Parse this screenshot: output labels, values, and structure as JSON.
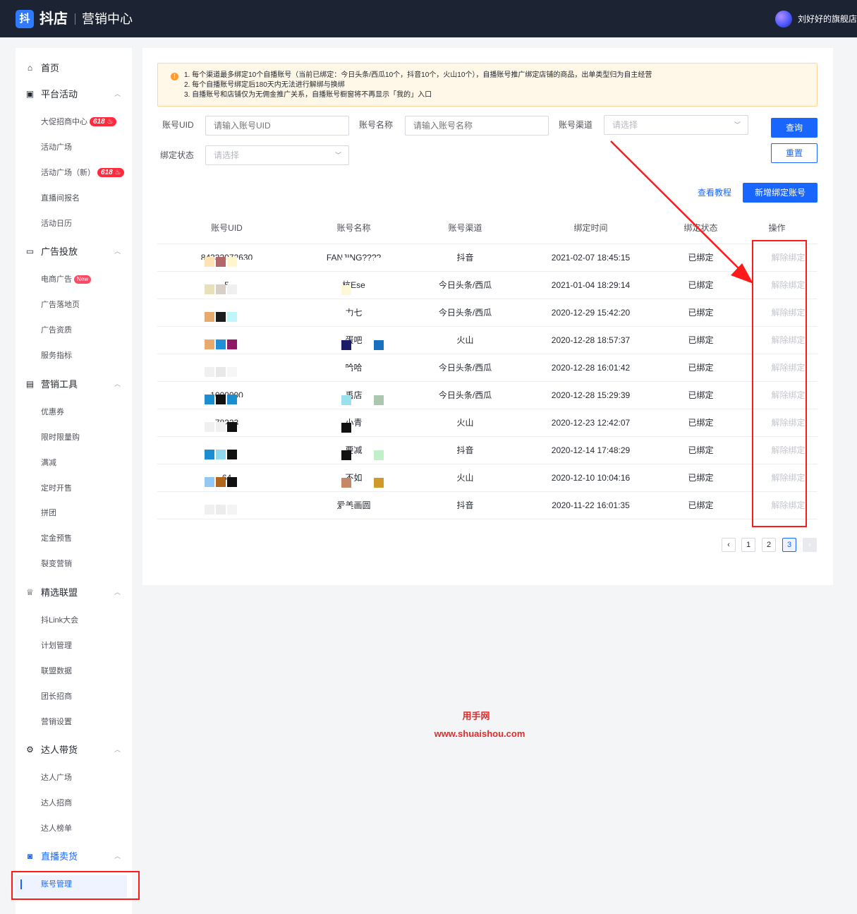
{
  "topbar": {
    "logo_glyph": "抖",
    "brand": "抖店",
    "product": "营销中心",
    "shop_name": "刘好好的旗舰店"
  },
  "sidebar": {
    "home": "首页",
    "groups": [
      {
        "label": "平台活动",
        "items": [
          "大促招商中心",
          "活动广场",
          "活动广场（新）",
          "直播间报名",
          "活动日历"
        ]
      },
      {
        "label": "广告投放",
        "items": [
          "电商广告",
          "广告落地页",
          "广告资质",
          "服务指标"
        ]
      },
      {
        "label": "营销工具",
        "items": [
          "优惠券",
          "限时限量购",
          "满减",
          "定时开售",
          "拼团",
          "定金预售",
          "裂变营销"
        ]
      },
      {
        "label": "精选联盟",
        "items": [
          "抖Link大会",
          "计划管理",
          "联盟数据",
          "团长招商",
          "营销设置"
        ]
      },
      {
        "label": "达人带货",
        "items": [
          "达人广场",
          "达人招商",
          "达人榜单"
        ]
      },
      {
        "label": "直播卖货",
        "items": [
          "账号管理"
        ]
      }
    ],
    "badge_618": "618",
    "badge_new": "New"
  },
  "notice": {
    "lines": [
      "1. 每个渠道最多绑定10个自播账号（当前已绑定：今日头条/西瓜10个，抖音10个，火山10个），自播账号推广绑定店铺的商品，出单类型归为自主经营",
      "2. 每个自播账号绑定后180天内无法进行解绑与换绑",
      "3. 自播账号和店铺仅为无佣金推广关系，自播账号橱窗将不再显示「我的」入口"
    ]
  },
  "filters": {
    "uid_label": "账号UID",
    "uid_placeholder": "请输入账号UID",
    "name_label": "账号名称",
    "name_placeholder": "请输入账号名称",
    "channel_label": "账号渠道",
    "channel_placeholder": "请选择",
    "status_label": "绑定状态",
    "status_placeholder": "请选择",
    "query_button": "查询",
    "reset_button": "重置"
  },
  "actions": {
    "tutorial_link": "查看教程",
    "add_button": "新增绑定账号"
  },
  "table": {
    "headers": [
      "账号UID",
      "账号名称",
      "账号渠道",
      "绑定时间",
      "绑定状态",
      "操作"
    ],
    "rows": [
      {
        "uid": "84333072630",
        "name": "FANJING????",
        "channel": "抖音",
        "time": "2021-02-07 18:45:15",
        "status": "已绑定",
        "op": "解除绑定"
      },
      {
        "uid": "5",
        "name": "杭Ese",
        "channel": "今日头条/西瓜",
        "time": "2021-01-04 18:29:14",
        "status": "已绑定",
        "op": "解除绑定"
      },
      {
        "uid": "",
        "name": "力七",
        "channel": "今日头条/西瓜",
        "time": "2020-12-29 15:42:20",
        "status": "已绑定",
        "op": "解除绑定"
      },
      {
        "uid": "",
        "name": "蛋吧",
        "channel": "火山",
        "time": "2020-12-28 18:57:37",
        "status": "已绑定",
        "op": "解除绑定"
      },
      {
        "uid": "",
        "name": "哈哈",
        "channel": "今日头条/西瓜",
        "time": "2020-12-28 16:01:42",
        "status": "已绑定",
        "op": "解除绑定"
      },
      {
        "uid": "1000000",
        "name": "禹店",
        "channel": "今日头条/西瓜",
        "time": "2020-12-28 15:29:39",
        "status": "已绑定",
        "op": "解除绑定"
      },
      {
        "uid": "78223",
        "name": "小青",
        "channel": "火山",
        "time": "2020-12-23 12:42:07",
        "status": "已绑定",
        "op": "解除绑定"
      },
      {
        "uid": "",
        "name": "要减",
        "channel": "抖音",
        "time": "2020-12-14 17:48:29",
        "status": "已绑定",
        "op": "解除绑定"
      },
      {
        "uid": "64",
        "name": "不如",
        "channel": "火山",
        "time": "2020-12-10 10:04:16",
        "status": "已绑定",
        "op": "解除绑定"
      },
      {
        "uid": "",
        "name": "爱美画圆",
        "channel": "抖音",
        "time": "2020-11-22 16:01:35",
        "status": "已绑定",
        "op": "解除绑定"
      }
    ]
  },
  "pagination": {
    "prev": "‹",
    "pages": [
      "1",
      "2",
      "3"
    ],
    "current": "3",
    "next": "›"
  },
  "watermark": {
    "line1": "用手网",
    "line2": "www.shuaishou.com"
  },
  "colors": {
    "accent": "#1966ff",
    "topbar": "#1c2333",
    "annotation": "#ff1a1a"
  }
}
